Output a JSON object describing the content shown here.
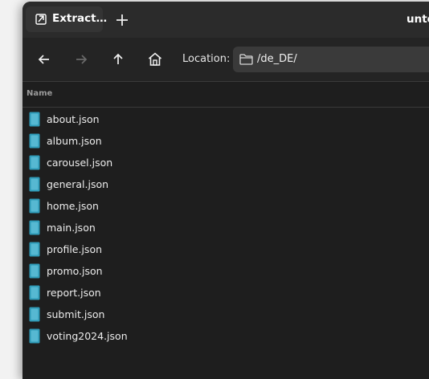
{
  "titlebar": {
    "tab_title": "Extract…",
    "window_title": "unto"
  },
  "toolbar": {
    "location_label": "Location:",
    "location_value": "/de_DE/"
  },
  "columns": {
    "name_header": "Name"
  },
  "files": [
    {
      "name": "about.json"
    },
    {
      "name": "album.json"
    },
    {
      "name": "carousel.json"
    },
    {
      "name": "general.json"
    },
    {
      "name": "home.json"
    },
    {
      "name": "main.json"
    },
    {
      "name": "profile.json"
    },
    {
      "name": "promo.json"
    },
    {
      "name": "report.json"
    },
    {
      "name": "submit.json"
    },
    {
      "name": "voting2024.json"
    }
  ],
  "icons": {
    "tab": "archive-extract-icon",
    "new_tab": "plus-icon",
    "back": "arrow-left-icon",
    "forward": "arrow-right-icon",
    "up": "arrow-up-icon",
    "home": "home-icon",
    "folder": "folder-icon",
    "file": "json-file-icon"
  },
  "colors": {
    "file_icon": "#2f9bb8",
    "window_bg": "#1e1e1e",
    "titlebar_bg": "#2b2b2b"
  }
}
